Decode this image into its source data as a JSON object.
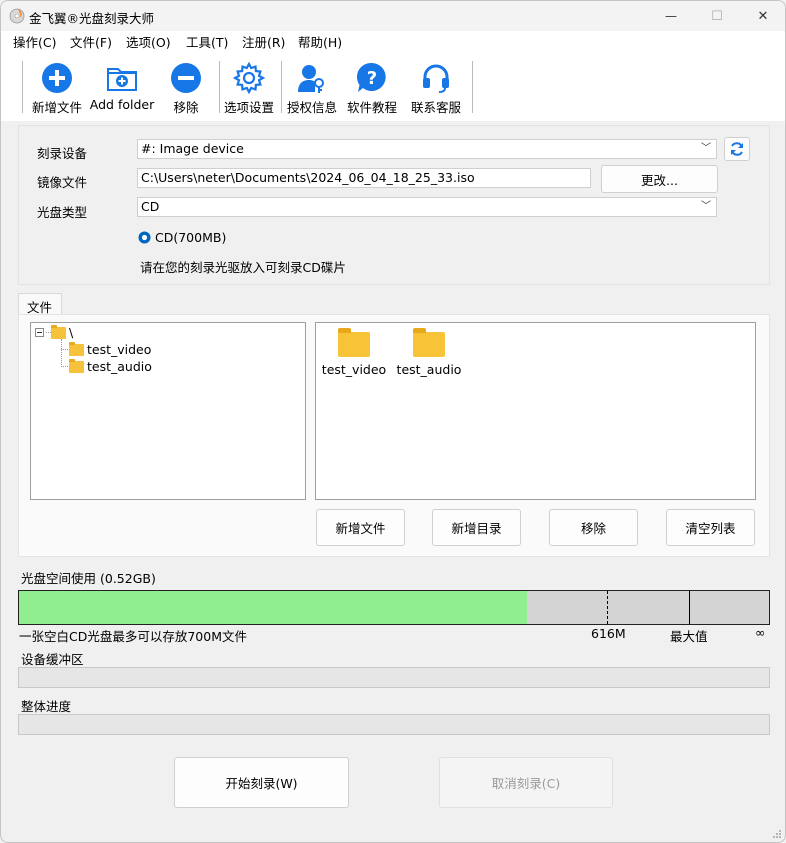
{
  "window": {
    "title": "金飞翼®光盘刻录大师",
    "controls": {
      "minimize": "—",
      "maximize": "☐",
      "close": "✕"
    }
  },
  "menu": [
    "操作(C)",
    "文件(F)",
    "选项(O)",
    "工具(T)",
    "注册(R)",
    "帮助(H)"
  ],
  "toolbar": {
    "buttons": [
      {
        "label": "新增文件",
        "icon": "plus-circle-icon"
      },
      {
        "label": "Add folder",
        "icon": "add-folder-icon"
      },
      {
        "label": "移除",
        "icon": "minus-circle-icon"
      },
      {
        "label": "选项设置",
        "icon": "gear-icon"
      },
      {
        "label": "授权信息",
        "icon": "key-user-icon"
      },
      {
        "label": "软件教程",
        "icon": "help-icon"
      },
      {
        "label": "联系客服",
        "icon": "headset-icon"
      }
    ]
  },
  "burn_settings": {
    "device_label": "刻录设备",
    "device_value": "#: Image device",
    "image_label": "镜像文件",
    "image_value": "C:\\Users\\neter\\Documents\\2024_06_04_18_25_33.iso",
    "change_button": "更改...",
    "disc_type_label": "光盘类型",
    "disc_type_value": "CD",
    "radio_option": "CD(700MB)",
    "hint": "请在您的刻录光驱放入可刻录CD碟片"
  },
  "files": {
    "tab": "文件",
    "tree_root": "\\",
    "tree_children": [
      "test_video",
      "test_audio"
    ],
    "items": [
      "test_video",
      "test_audio"
    ],
    "buttons": [
      "新增文件",
      "新增目录",
      "移除",
      "清空列表"
    ]
  },
  "capacity": {
    "label": "光盘空间使用",
    "used": "(0.52GB)",
    "used_fraction": 0.677,
    "mark_616_fraction": 0.784,
    "mark_max_fraction": 0.893,
    "note": "一张空白CD光盘最多可以存放700M文件",
    "mark_616": "616M",
    "mark_max": "最大值",
    "mark_inf": "∞",
    "fill_color": "#90ee90"
  },
  "buffer": {
    "label": "设备缓冲区"
  },
  "progress": {
    "label": "整体进度"
  },
  "actions": {
    "start": "开始刻录(W)",
    "cancel": "取消刻录(C)"
  }
}
